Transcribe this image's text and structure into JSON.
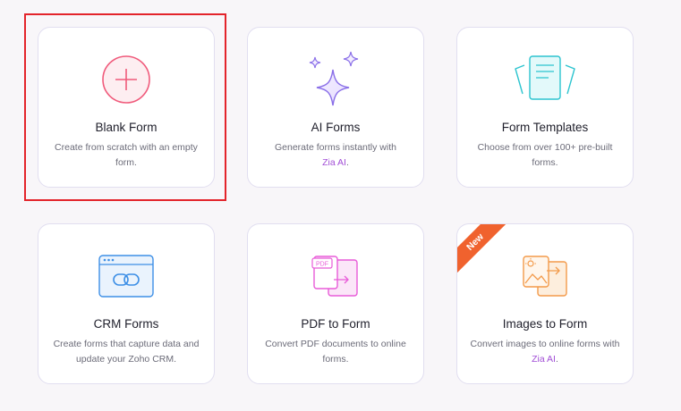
{
  "cards": {
    "blank": {
      "title": "Blank Form",
      "desc_line1": "Create from scratch with an empty",
      "desc_line2": "form.",
      "icon": "plus-circle-icon",
      "accent": "#f05a7b"
    },
    "ai": {
      "title": "AI Forms",
      "desc_line1": "Generate forms instantly with",
      "desc_link": "Zia AI",
      "desc_suffix": ".",
      "icon": "sparkle-icon",
      "accent": "#8a6fe8"
    },
    "templates": {
      "title": "Form Templates",
      "desc_line1": "Choose from over 100+ pre-built",
      "desc_line2": "forms.",
      "icon": "template-document-icon",
      "accent": "#2cc4cf"
    },
    "crm": {
      "title": "CRM Forms",
      "desc_line1": "Create forms that capture data and",
      "desc_line2": "update your Zoho CRM.",
      "icon": "crm-window-link-icon",
      "accent": "#3d8fe6"
    },
    "pdf": {
      "title": "PDF to Form",
      "desc_line1": "Convert PDF documents to online",
      "desc_line2": "forms.",
      "icon": "pdf-convert-icon",
      "icon_badge": "PDF",
      "accent": "#e85bd8"
    },
    "images": {
      "title": "Images to Form",
      "desc_line1": "Convert images to online forms with",
      "desc_link": "Zia AI",
      "desc_suffix": ".",
      "icon": "image-convert-icon",
      "accent": "#f39a4a",
      "badge": "New",
      "badge_color": "#f0622e"
    }
  },
  "highlight_color": "#e3242b",
  "link_color": "#a24fd6"
}
